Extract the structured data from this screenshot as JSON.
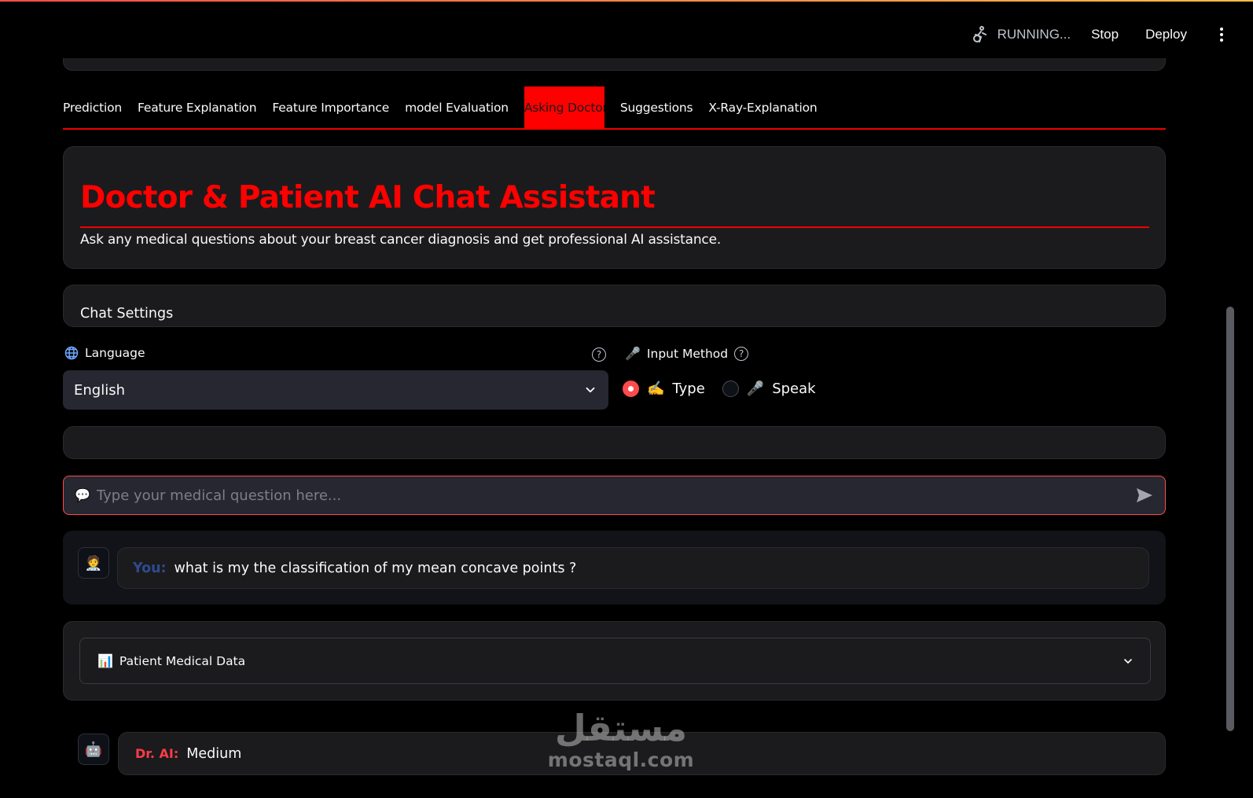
{
  "toolbar": {
    "status": "RUNNING...",
    "stop_label": "Stop",
    "deploy_label": "Deploy"
  },
  "tabs": [
    {
      "label": "Prediction"
    },
    {
      "label": "Feature Explanation"
    },
    {
      "label": "Feature Importance"
    },
    {
      "label": "model Evaluation"
    },
    {
      "label": "Asking Doctor",
      "active": true
    },
    {
      "label": "Suggestions"
    },
    {
      "label": "X-Ray-Explanation"
    }
  ],
  "hero": {
    "title": "Doctor & Patient AI Chat Assistant",
    "subtitle": "Ask any medical questions about your breast cancer diagnosis and get professional AI assistance."
  },
  "settings": {
    "title": "Chat Settings"
  },
  "language": {
    "label": "Language",
    "selected": "English"
  },
  "input_method": {
    "label": "Input Method",
    "options": [
      {
        "label": "Type",
        "emoji": "✍️",
        "checked": true
      },
      {
        "label": "Speak",
        "emoji": "🎤",
        "checked": false
      }
    ]
  },
  "chat_input": {
    "placeholder": "Type your medical question here..."
  },
  "messages": {
    "user_prefix": "You:",
    "user_text": "what is my the classification of my mean concave points ?",
    "ai_prefix": "Dr. AI:",
    "ai_text": "Medium"
  },
  "patient_data": {
    "label": "Patient Medical Data"
  },
  "watermark": {
    "arabic": "مستقل",
    "latin": "mostaql.com"
  },
  "colors": {
    "accent": "#ff0000",
    "streamlit_red": "#ff4b4b",
    "background": "#000000"
  }
}
